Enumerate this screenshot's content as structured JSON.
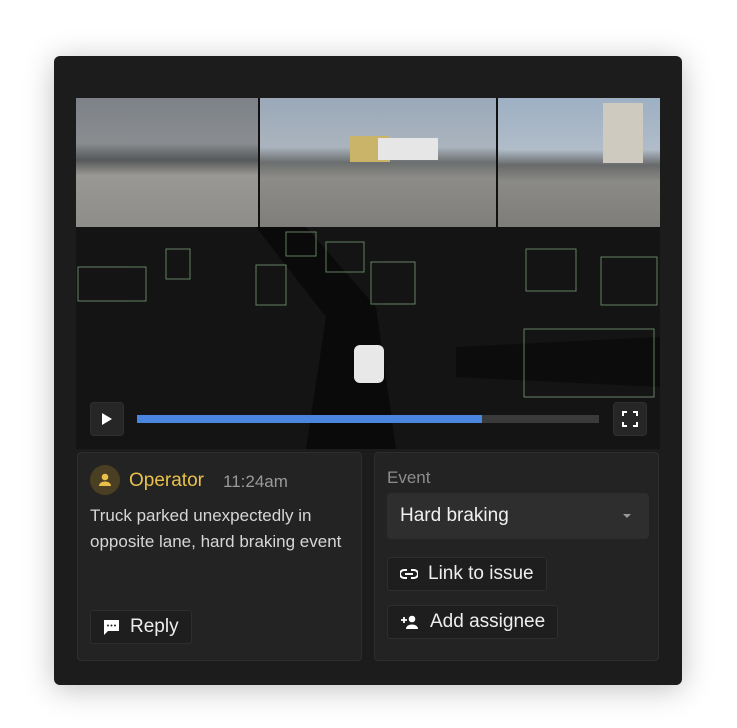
{
  "player": {
    "progress": 0.746
  },
  "comment": {
    "author": "Operator",
    "time": "11:24am",
    "text": "Truck parked unexpectedly in opposite lane, hard braking event",
    "reply_label": "Reply"
  },
  "event": {
    "label": "Event",
    "selected": "Hard braking",
    "link_label": "Link to issue",
    "assign_label": "Add assignee"
  },
  "colors": {
    "accent": "#4a86e0",
    "author": "#e8c04a"
  }
}
